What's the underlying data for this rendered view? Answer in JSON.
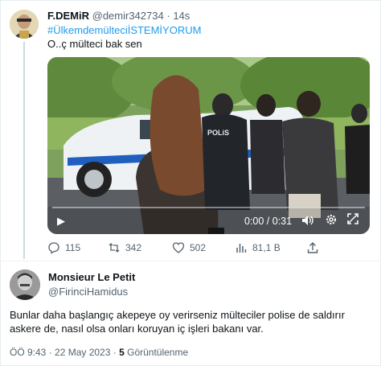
{
  "quoted_tweet": {
    "display_name": "F.DEMiR",
    "handle": "@demir342734",
    "separator": "·",
    "time_ago": "14s",
    "hashtag": "#ÜlkemdemülteciİSTEMİYORUM",
    "text": "O..ç mülteci bak sen",
    "video": {
      "time": "0:00 / 0:31",
      "progress": 0,
      "police_label": "POLiS"
    },
    "actions": {
      "replies": "115",
      "retweets": "342",
      "likes": "502",
      "views": "81,1 B"
    }
  },
  "main_tweet": {
    "display_name": "Monsieur Le Petit",
    "handle": "@FirinciHamidus",
    "text": "Bunlar daha başlangıç akepeye oy verirseniz mülteciler polise de saldırır askere de, nasıl olsa onları koruyan iç işleri bakanı var.",
    "time": "ÖÖ 9:43 · 22 May 2023 · ",
    "views_count": "5",
    "views_label": "Görüntülenme"
  },
  "colors": {
    "link": "#1d9bf0",
    "muted": "#536471",
    "text": "#0f1419"
  }
}
